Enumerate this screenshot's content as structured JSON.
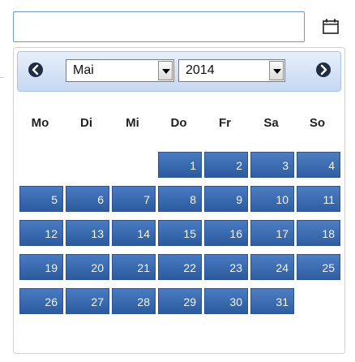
{
  "date_input": {
    "value": "",
    "placeholder": ""
  },
  "calendar_icon": "calendar-icon",
  "header": {
    "prev_icon": "chevron-left-icon",
    "next_icon": "chevron-right-icon",
    "month_selected": "Mai",
    "year_selected": "2014"
  },
  "weekdays": [
    "Mo",
    "Di",
    "Mi",
    "Do",
    "Fr",
    "Sa",
    "So"
  ],
  "month": {
    "first_weekday_index": 6,
    "days": [
      "1",
      "2",
      "3",
      "4",
      "5",
      "6",
      "7",
      "8",
      "9",
      "10",
      "11",
      "12",
      "13",
      "14",
      "15",
      "16",
      "17",
      "18",
      "19",
      "20",
      "21",
      "22",
      "23",
      "24",
      "25",
      "26",
      "27",
      "28",
      "29",
      "30",
      "31"
    ]
  },
  "colors": {
    "day_cell": "#3a69ae",
    "header_bg": "#c6d8f2",
    "input_border": "#6f98d6"
  }
}
